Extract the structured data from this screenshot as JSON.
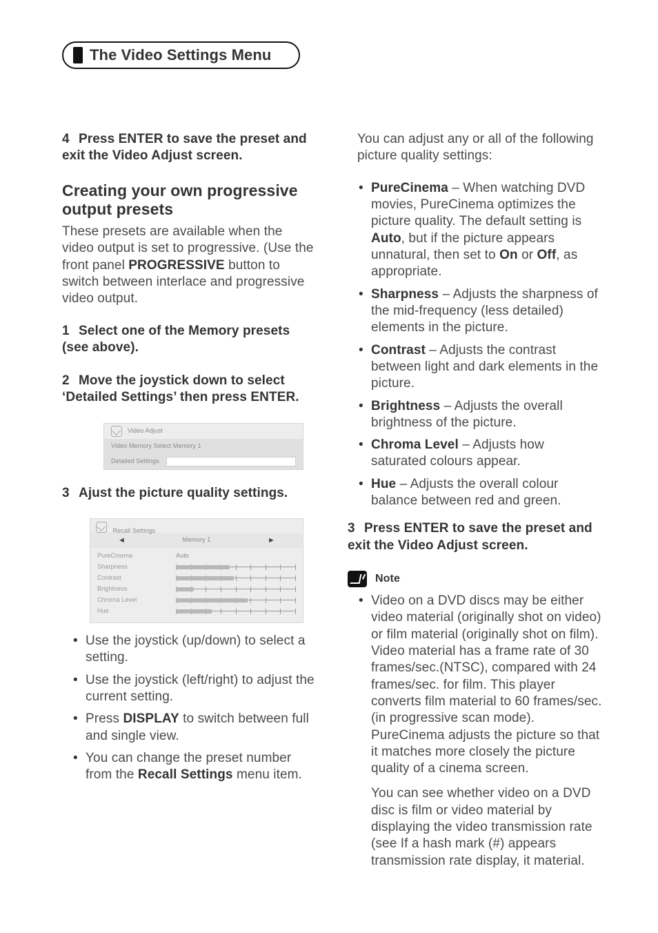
{
  "chapterTab": "The Video Settings Menu",
  "left": {
    "step4": "Press ENTER to save the preset and exit the Video Adjust screen.",
    "subhead": "Creating your own progressive output presets",
    "intro_pre": "These presets are available when the video output is set to progressive. (Use the front panel ",
    "intro_btn": "PROGRESSIVE",
    "intro_post": " button to switch between interlace and progressive video output.",
    "step1": "Select one of the Memory presets (see above).",
    "step2": "Move the joystick down to select ‘Detailed Settings’ then press ENTER.",
    "step3": "Ajust the picture quality settings.",
    "bullets": [
      "Use the joystick (up/down) to select a setting.",
      "Use the joystick (left/right) to adjust the current setting."
    ],
    "bullet_display_pre": "Press ",
    "bullet_display_btn": "DISPLAY",
    "bullet_display_post": " to switch between full and single view.",
    "bullet_recall_pre": "You can change the preset number from the ",
    "bullet_recall_btn": "Recall Settings",
    "bullet_recall_post": " menu item.",
    "ui1": {
      "title": "Video Adjust",
      "row1": "Video Memory Select   Memory 1",
      "row2": "Detailed Settings"
    },
    "ui2": {
      "recall": "Recall Settings",
      "mem": "Memory 1",
      "lines": [
        {
          "lbl": "PureCinema",
          "val": "Auto"
        },
        {
          "lbl": "Sharpness",
          "fill": 45
        },
        {
          "lbl": "Contrast",
          "fill": 48
        },
        {
          "lbl": "Brightness",
          "fill": 15
        },
        {
          "lbl": "Chroma Level",
          "fill": 60
        },
        {
          "lbl": "Hue",
          "fill": 30
        }
      ]
    }
  },
  "right": {
    "lead": "You can adjust any or all of the following picture quality settings:",
    "items": [
      {
        "name": "PureCinema",
        "pre": " – When watching DVD movies, PureCinema optimizes the picture quality. The default setting is ",
        "mid1": "Auto",
        "mid2": ", but if the picture appears unnatural, then set to ",
        "mid3": "On",
        "mid4": " or ",
        "mid5": "Off",
        "post": ", as appropriate."
      },
      {
        "name": "Sharpness",
        "post": " – Adjusts the sharpness of the mid-frequency (less detailed) elements in the picture."
      },
      {
        "name": "Contrast",
        "post": " – Adjusts the contrast between light and dark elements in the picture."
      },
      {
        "name": "Brightness",
        "post": " – Adjusts the overall brightness of the picture."
      },
      {
        "name": "Chroma Level",
        "post": " – Adjusts how saturated colours appear."
      },
      {
        "name": "Hue",
        "post": " – Adjusts the overall colour balance between red and green."
      }
    ],
    "step3": "Press ENTER to save the preset and exit the Video Adjust screen.",
    "noteLabel": "Note",
    "noteBody": "Video on a DVD discs may be either video material (originally shot on video) or film material (originally shot on film). Video material has a frame rate of 30 frames/sec.(NTSC), compared with 24 frames/sec. for film. This player converts film material to 60 frames/sec. (in progressive scan mode). PureCinema adjusts the picture so that it matches more closely the picture quality of a cinema screen.",
    "noteFollow": "You can see whether video on a DVD disc is film or video material by displaying the video transmission rate (see If a hash mark (#) appears transmission rate display, it  material."
  },
  "pageNum": ""
}
